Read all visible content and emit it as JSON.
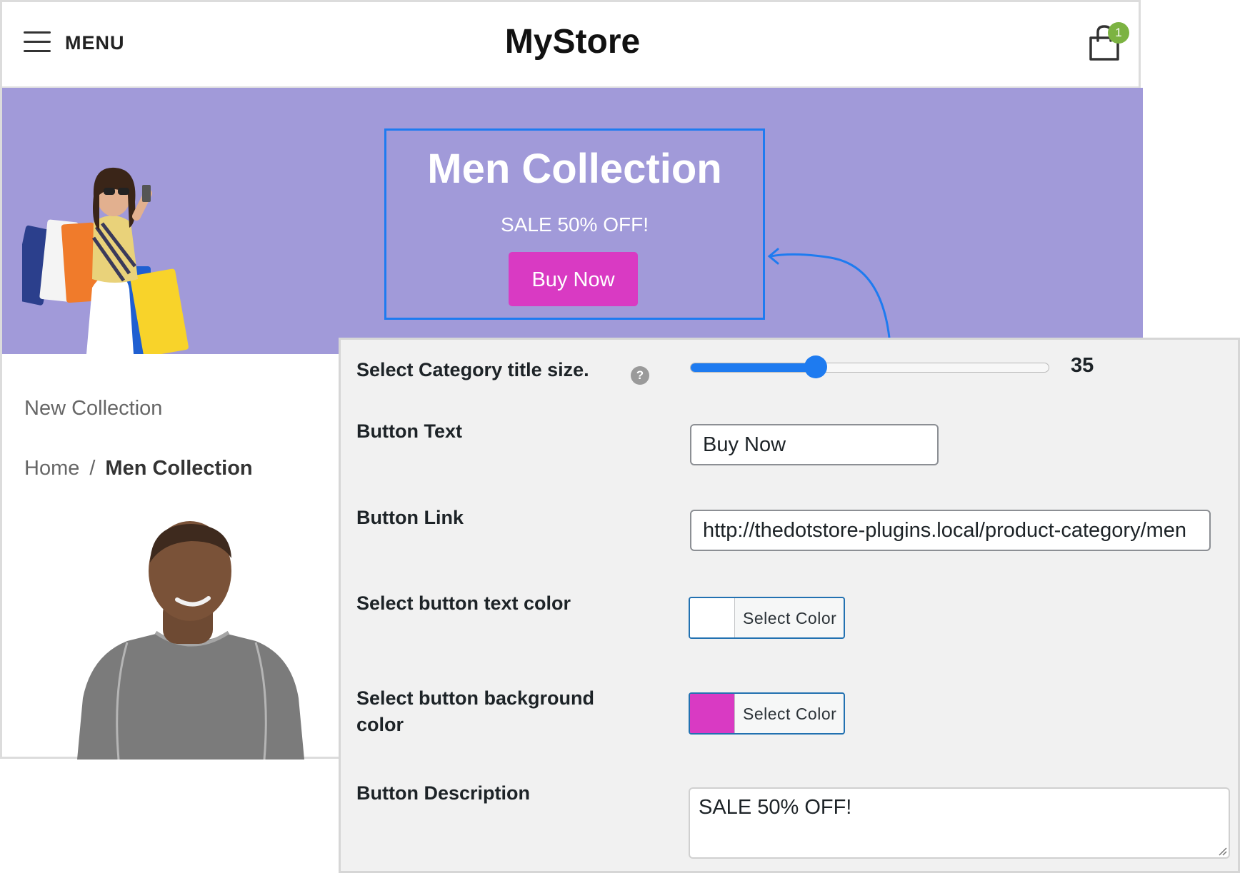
{
  "header": {
    "menu_label": "MENU",
    "brand": "MyStore",
    "cart_count": "1"
  },
  "hero": {
    "title": "Men Collection",
    "subtitle": "SALE 50% OFF!",
    "button_label": "Buy Now",
    "background_color": "#a19ad9",
    "button_color": "#d93ac3"
  },
  "page": {
    "new_collection": "New Collection",
    "breadcrumb": {
      "home": "Home",
      "separator": "/",
      "current": "Men Collection"
    }
  },
  "settings": {
    "title_size": {
      "label": "Select Category title size.",
      "help": "?",
      "value": "35",
      "min": 0,
      "max": 100
    },
    "button_text": {
      "label": "Button Text",
      "value": "Buy Now"
    },
    "button_link": {
      "label": "Button Link",
      "value": "http://thedotstore-plugins.local/product-category/men"
    },
    "text_color": {
      "label": "Select button text color",
      "swatch": "#ffffff",
      "button_label": "Select Color"
    },
    "bg_color": {
      "label": "Select button background color",
      "swatch": "#d93ac3",
      "button_label": "Select Color"
    },
    "description": {
      "label": "Button Description",
      "value": "SALE 50% OFF!"
    }
  }
}
